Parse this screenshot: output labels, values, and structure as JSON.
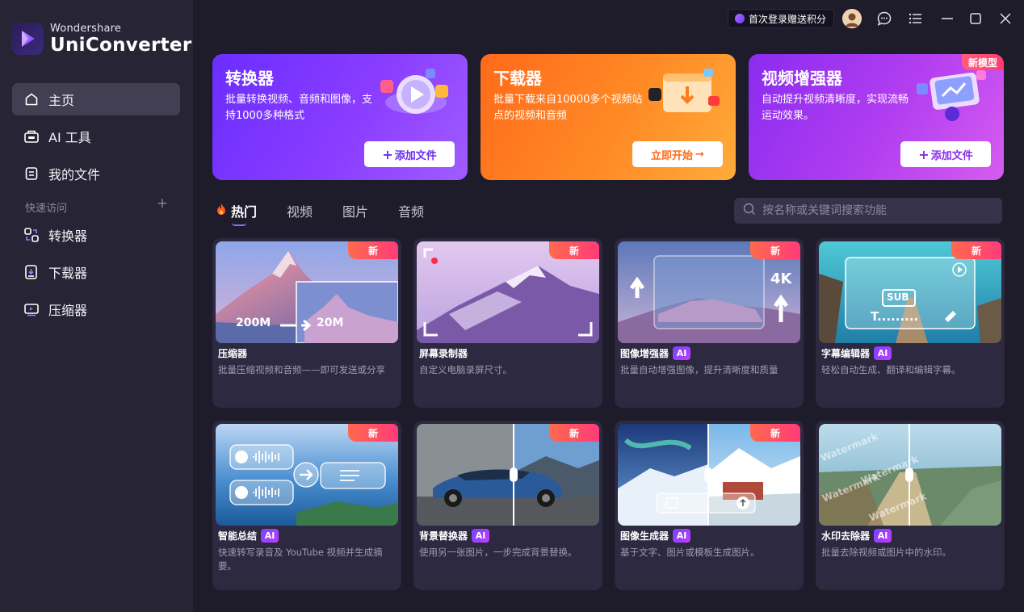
{
  "app": {
    "brand_small": "Wondershare",
    "brand_big": "UniConverter"
  },
  "sidebar": {
    "items": [
      {
        "label": "主页",
        "icon": "home-icon",
        "active": true
      },
      {
        "label": "AI 工具",
        "icon": "ai-tools-icon"
      },
      {
        "label": "我的文件",
        "icon": "file-icon"
      }
    ],
    "quick_title": "快速访问",
    "quick_items": [
      {
        "label": "转换器",
        "icon": "converter-icon"
      },
      {
        "label": "下载器",
        "icon": "downloader-icon"
      },
      {
        "label": "压缩器",
        "icon": "compressor-icon"
      }
    ]
  },
  "topbar": {
    "promo": "首次登录赠送积分"
  },
  "top_cards": [
    {
      "title": "转换器",
      "desc": "批量转换视频、音频和图像，支持1000多种格式",
      "button": "添加文件",
      "color": "#7b3bff"
    },
    {
      "title": "下载器",
      "desc": "批量下载来自10000多个视频站点的视频和音频",
      "button": "立即开始",
      "color": "#ff7a1f"
    },
    {
      "title": "视频增强器",
      "desc": "自动提升视频清晰度，实现流畅运动效果。",
      "button": "添加文件",
      "badge": "新模型",
      "color": "#a63cf0"
    }
  ],
  "tabs": [
    {
      "label": "热门",
      "active": true
    },
    {
      "label": "视频"
    },
    {
      "label": "图片"
    },
    {
      "label": "音频"
    }
  ],
  "search": {
    "placeholder": "按名称或关键词搜索功能"
  },
  "new_label": "新",
  "ai_label": "AI",
  "tools": [
    {
      "name": "压缩器",
      "desc": "批量压缩视频和音频——即可发送或分享",
      "img_text_a": "200M",
      "img_text_b": "20M"
    },
    {
      "name": "屏幕录制器",
      "desc": "自定义电脑录屏尺寸。"
    },
    {
      "name": "图像增强器",
      "desc": "批量自动增强图像，提升清晰度和质量",
      "ai": true,
      "img_text_a": "4K"
    },
    {
      "name": "字幕编辑器",
      "desc": "轻松自动生成、翻译和编辑字幕。",
      "ai": true,
      "img_text_a": "SUB",
      "img_text_b": "T........."
    },
    {
      "name": "智能总结",
      "desc": "快速转写录音及 YouTube 视频并生成摘要。",
      "ai": true
    },
    {
      "name": "背景替换器",
      "desc": "使用另一张图片，一步完成背景替换。",
      "ai": true
    },
    {
      "name": "图像生成器",
      "desc": "基于文字、图片或模板生成图片。",
      "ai": true
    },
    {
      "name": "水印去除器",
      "desc": "批量去除视频或图片中的水印。",
      "ai": true,
      "img_text_a": "Watermark"
    }
  ]
}
